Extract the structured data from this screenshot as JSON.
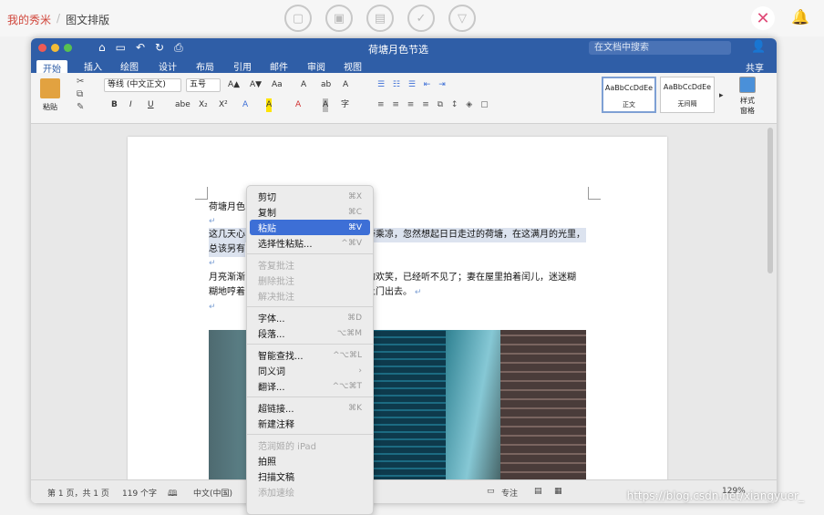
{
  "breadcrumb": {
    "home": "我的秀米",
    "sep": "/",
    "current": "图文排版"
  },
  "toolbar_icons": [
    "image-icon",
    "photo-icon",
    "print-icon",
    "check-icon",
    "dropdown-icon"
  ],
  "window": {
    "title": "荷塘月色节选",
    "search_placeholder": "在文档中搜索"
  },
  "tabs": [
    "开始",
    "插入",
    "绘图",
    "设计",
    "布局",
    "引用",
    "邮件",
    "审阅",
    "视图"
  ],
  "share": "共享",
  "ribbon": {
    "paste": "粘贴",
    "font": "等线 (中文正文)",
    "size": "五号",
    "styles": [
      {
        "sample": "AaBbCcDdEe",
        "name": "正文"
      },
      {
        "sample": "AaBbCcDdEe",
        "name": "无间隔"
      }
    ],
    "style_pane": "样式\n窗格",
    "f1": [
      "A▲",
      "A▼",
      "Aa",
      "A",
      "ab",
      "A"
    ],
    "f2": [
      "B",
      "I",
      "U",
      "abe",
      "X₂",
      "X²",
      "A",
      "A",
      "A",
      "A",
      "字"
    ]
  },
  "doc": {
    "l1": "荷塘月色",
    "l2a": "这几天心",
    "l2b": "带乘凉，忽然想起日日走过的荷塘，在这满月的光里，",
    "l3": "总该另有",
    "l4a": "月亮渐渐",
    "l4b": "的欢笑，已经听不见了；妻在屋里拍着闰儿，迷迷糊",
    "l5a": "糊地哼着",
    "l5b": "上门出去。"
  },
  "menu": [
    {
      "label": "剪切",
      "key": "⌘X"
    },
    {
      "label": "复制",
      "key": "⌘C"
    },
    {
      "label": "粘贴",
      "key": "⌘V",
      "active": true
    },
    {
      "label": "选择性粘贴...",
      "key": "^⌘V"
    },
    {
      "sep": true
    },
    {
      "label": "答复批注",
      "dis": true
    },
    {
      "label": "删除批注",
      "dis": true
    },
    {
      "label": "解决批注",
      "dis": true
    },
    {
      "sep": true
    },
    {
      "label": "字体...",
      "key": "⌘D"
    },
    {
      "label": "段落...",
      "key": "⌥⌘M"
    },
    {
      "sep": true
    },
    {
      "label": "智能查找...",
      "key": "^⌥⌘L"
    },
    {
      "label": "同义词",
      "key": "›"
    },
    {
      "label": "翻译...",
      "key": "^⌥⌘T"
    },
    {
      "sep": true
    },
    {
      "label": "超链接...",
      "key": "⌘K"
    },
    {
      "label": "新建注释"
    },
    {
      "sep": true
    },
    {
      "label": "范润姬的 iPad",
      "dis": true
    },
    {
      "label": "拍照"
    },
    {
      "label": "扫描文稿"
    },
    {
      "label": "添加速绘",
      "dis": true
    }
  ],
  "status": {
    "page": "第 1 页，共 1 页",
    "words": "119 个字",
    "lang": "中文(中国)",
    "focus": "专注",
    "zoom": "129%"
  },
  "watermark": "https://blog.csdn.net/xiangyuer_"
}
